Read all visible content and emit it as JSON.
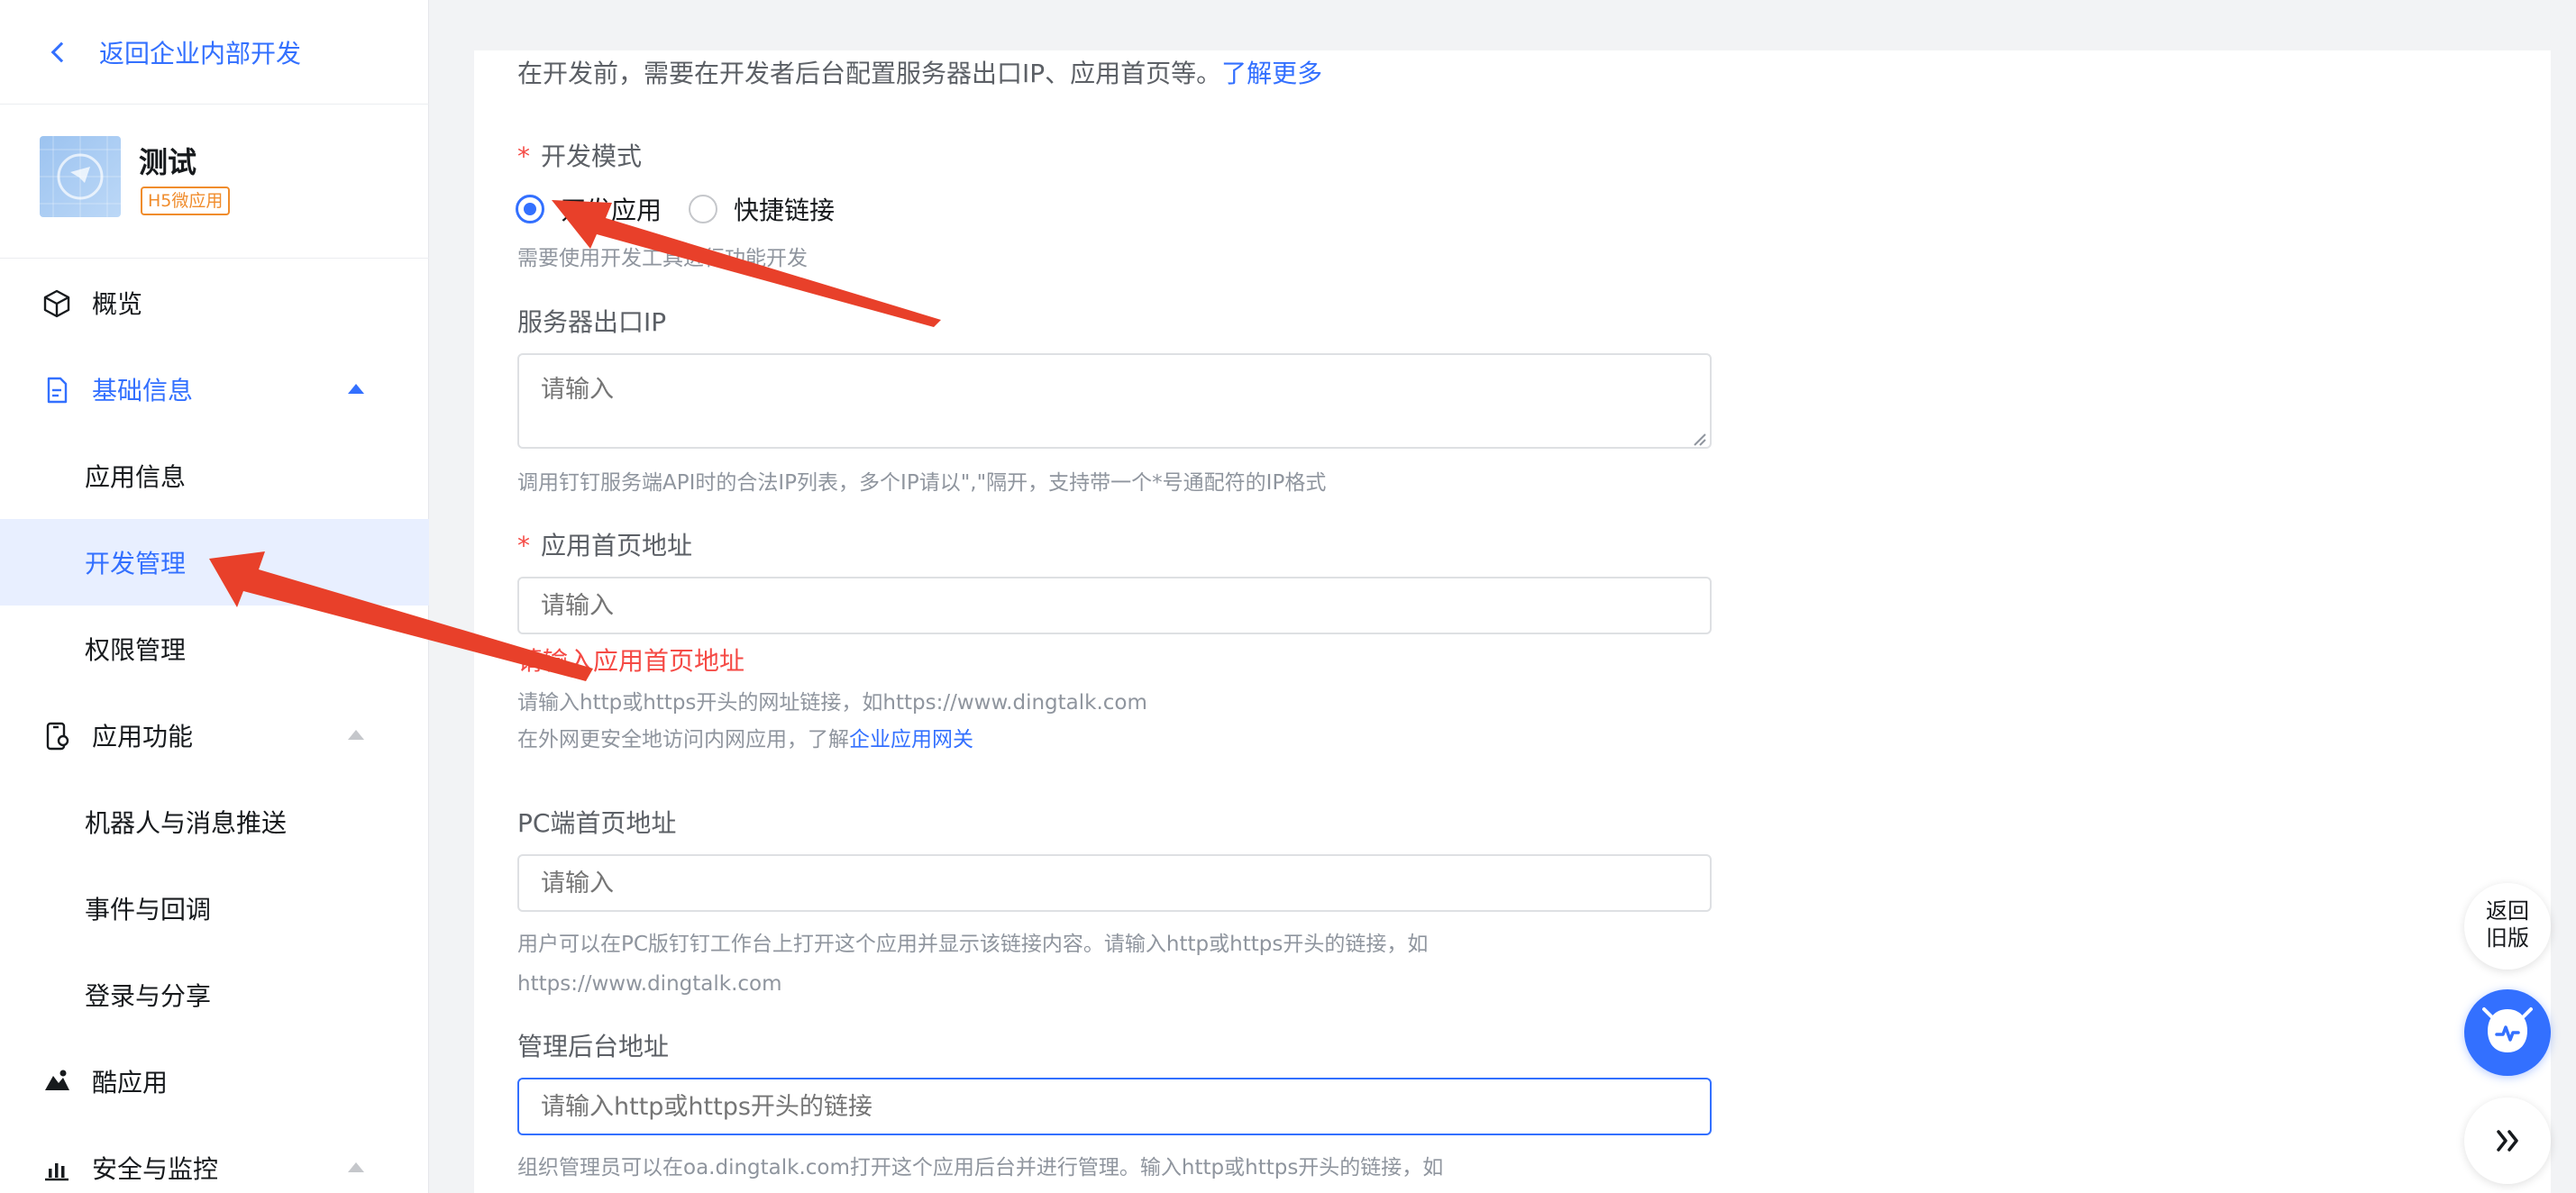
{
  "sidebar": {
    "back_label": "返回企业内部开发",
    "app": {
      "name": "测试",
      "tag": "H5微应用"
    },
    "items": [
      {
        "label": "概览",
        "icon": "cube-icon"
      },
      {
        "label": "基础信息",
        "icon": "document-icon",
        "expanded": true
      },
      {
        "label": "应用信息"
      },
      {
        "label": "开发管理",
        "active": true
      },
      {
        "label": "权限管理"
      },
      {
        "label": "应用功能",
        "icon": "phone-settings-icon"
      },
      {
        "label": "机器人与消息推送"
      },
      {
        "label": "事件与回调"
      },
      {
        "label": "登录与分享"
      },
      {
        "label": "酷应用",
        "icon": "cool-app-icon"
      },
      {
        "label": "安全与监控",
        "icon": "bar-chart-icon"
      }
    ]
  },
  "main": {
    "intro_text": "在开发前，需要在开发者后台配置服务器出口IP、应用首页等。",
    "intro_link": "了解更多",
    "dev_mode": {
      "label": "开发模式",
      "options": [
        "开发应用",
        "快捷链接"
      ],
      "selected": "开发应用",
      "hint": "需要使用开发工具进行功能开发"
    },
    "server_ip": {
      "label": "服务器出口IP",
      "placeholder": "请输入",
      "hint": "调用钉钉服务端API时的合法IP列表，多个IP请以\",\"隔开，支持带一个*号通配符的IP格式"
    },
    "homepage": {
      "label": "应用首页地址",
      "placeholder": "请输入",
      "error": "请输入应用首页地址",
      "hint1": "请输入http或https开头的网址链接，如https://www.dingtalk.com",
      "hint2_prefix": "在外网更安全地访问内网应用，了解",
      "hint2_link": "企业应用网关"
    },
    "pc_homepage": {
      "label": "PC端首页地址",
      "placeholder": "请输入",
      "hint1": "用户可以在PC版钉钉工作台上打开这个应用并显示该链接内容。请输入http或https开头的链接，如",
      "hint2": "https://www.dingtalk.com"
    },
    "admin_url": {
      "label": "管理后台地址",
      "placeholder": "请输入http或https开头的链接",
      "hint": "组织管理员可以在oa.dingtalk.com打开这个应用后台并进行管理。输入http或https开头的链接，如"
    }
  },
  "floating": {
    "old_version_line1": "返回",
    "old_version_line2": "旧版"
  },
  "colors": {
    "accent": "#3370ff",
    "error": "#f54a45",
    "tag": "#f08c2c",
    "annotation_arrow": "#e8402a"
  }
}
